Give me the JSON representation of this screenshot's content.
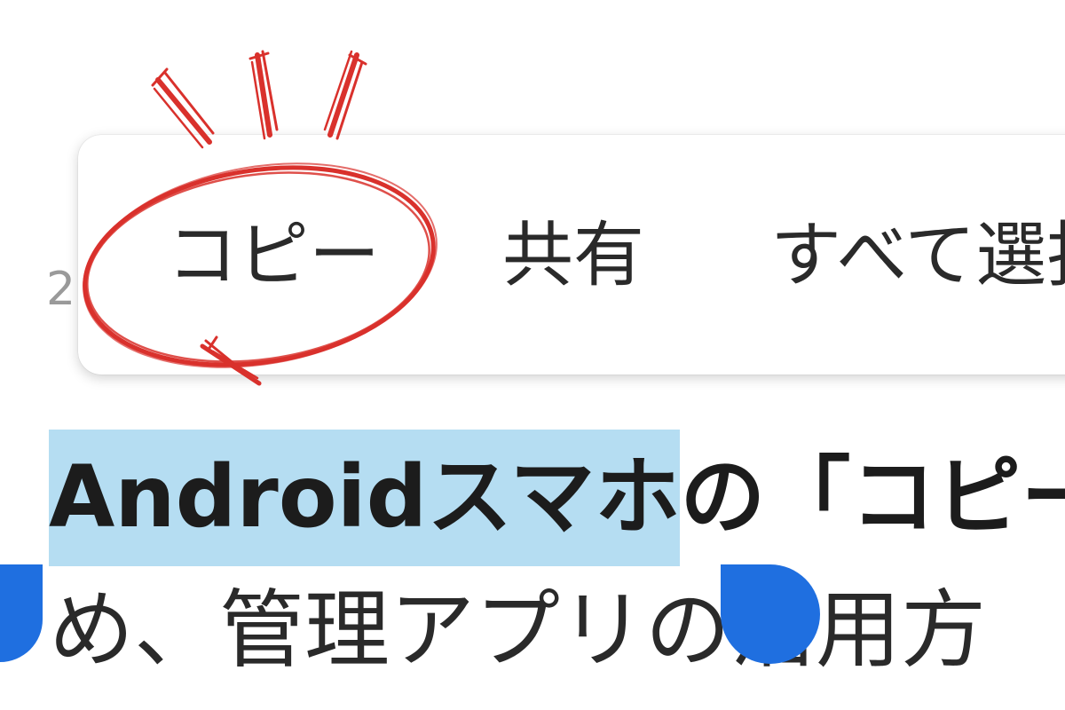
{
  "background_digit": "2",
  "toolbar": {
    "copy_label": "コピー",
    "share_label": "共有",
    "select_all_label": "すべて選択"
  },
  "text": {
    "line1_selected": "Androidスマホ",
    "line1_rest": "の「コピー」",
    "line2": "め、管理アプリの活用方"
  },
  "colors": {
    "selection_highlight": "#b5ddf2",
    "selection_handle": "#1f6fe0",
    "annotation_red": "#d9312c"
  }
}
